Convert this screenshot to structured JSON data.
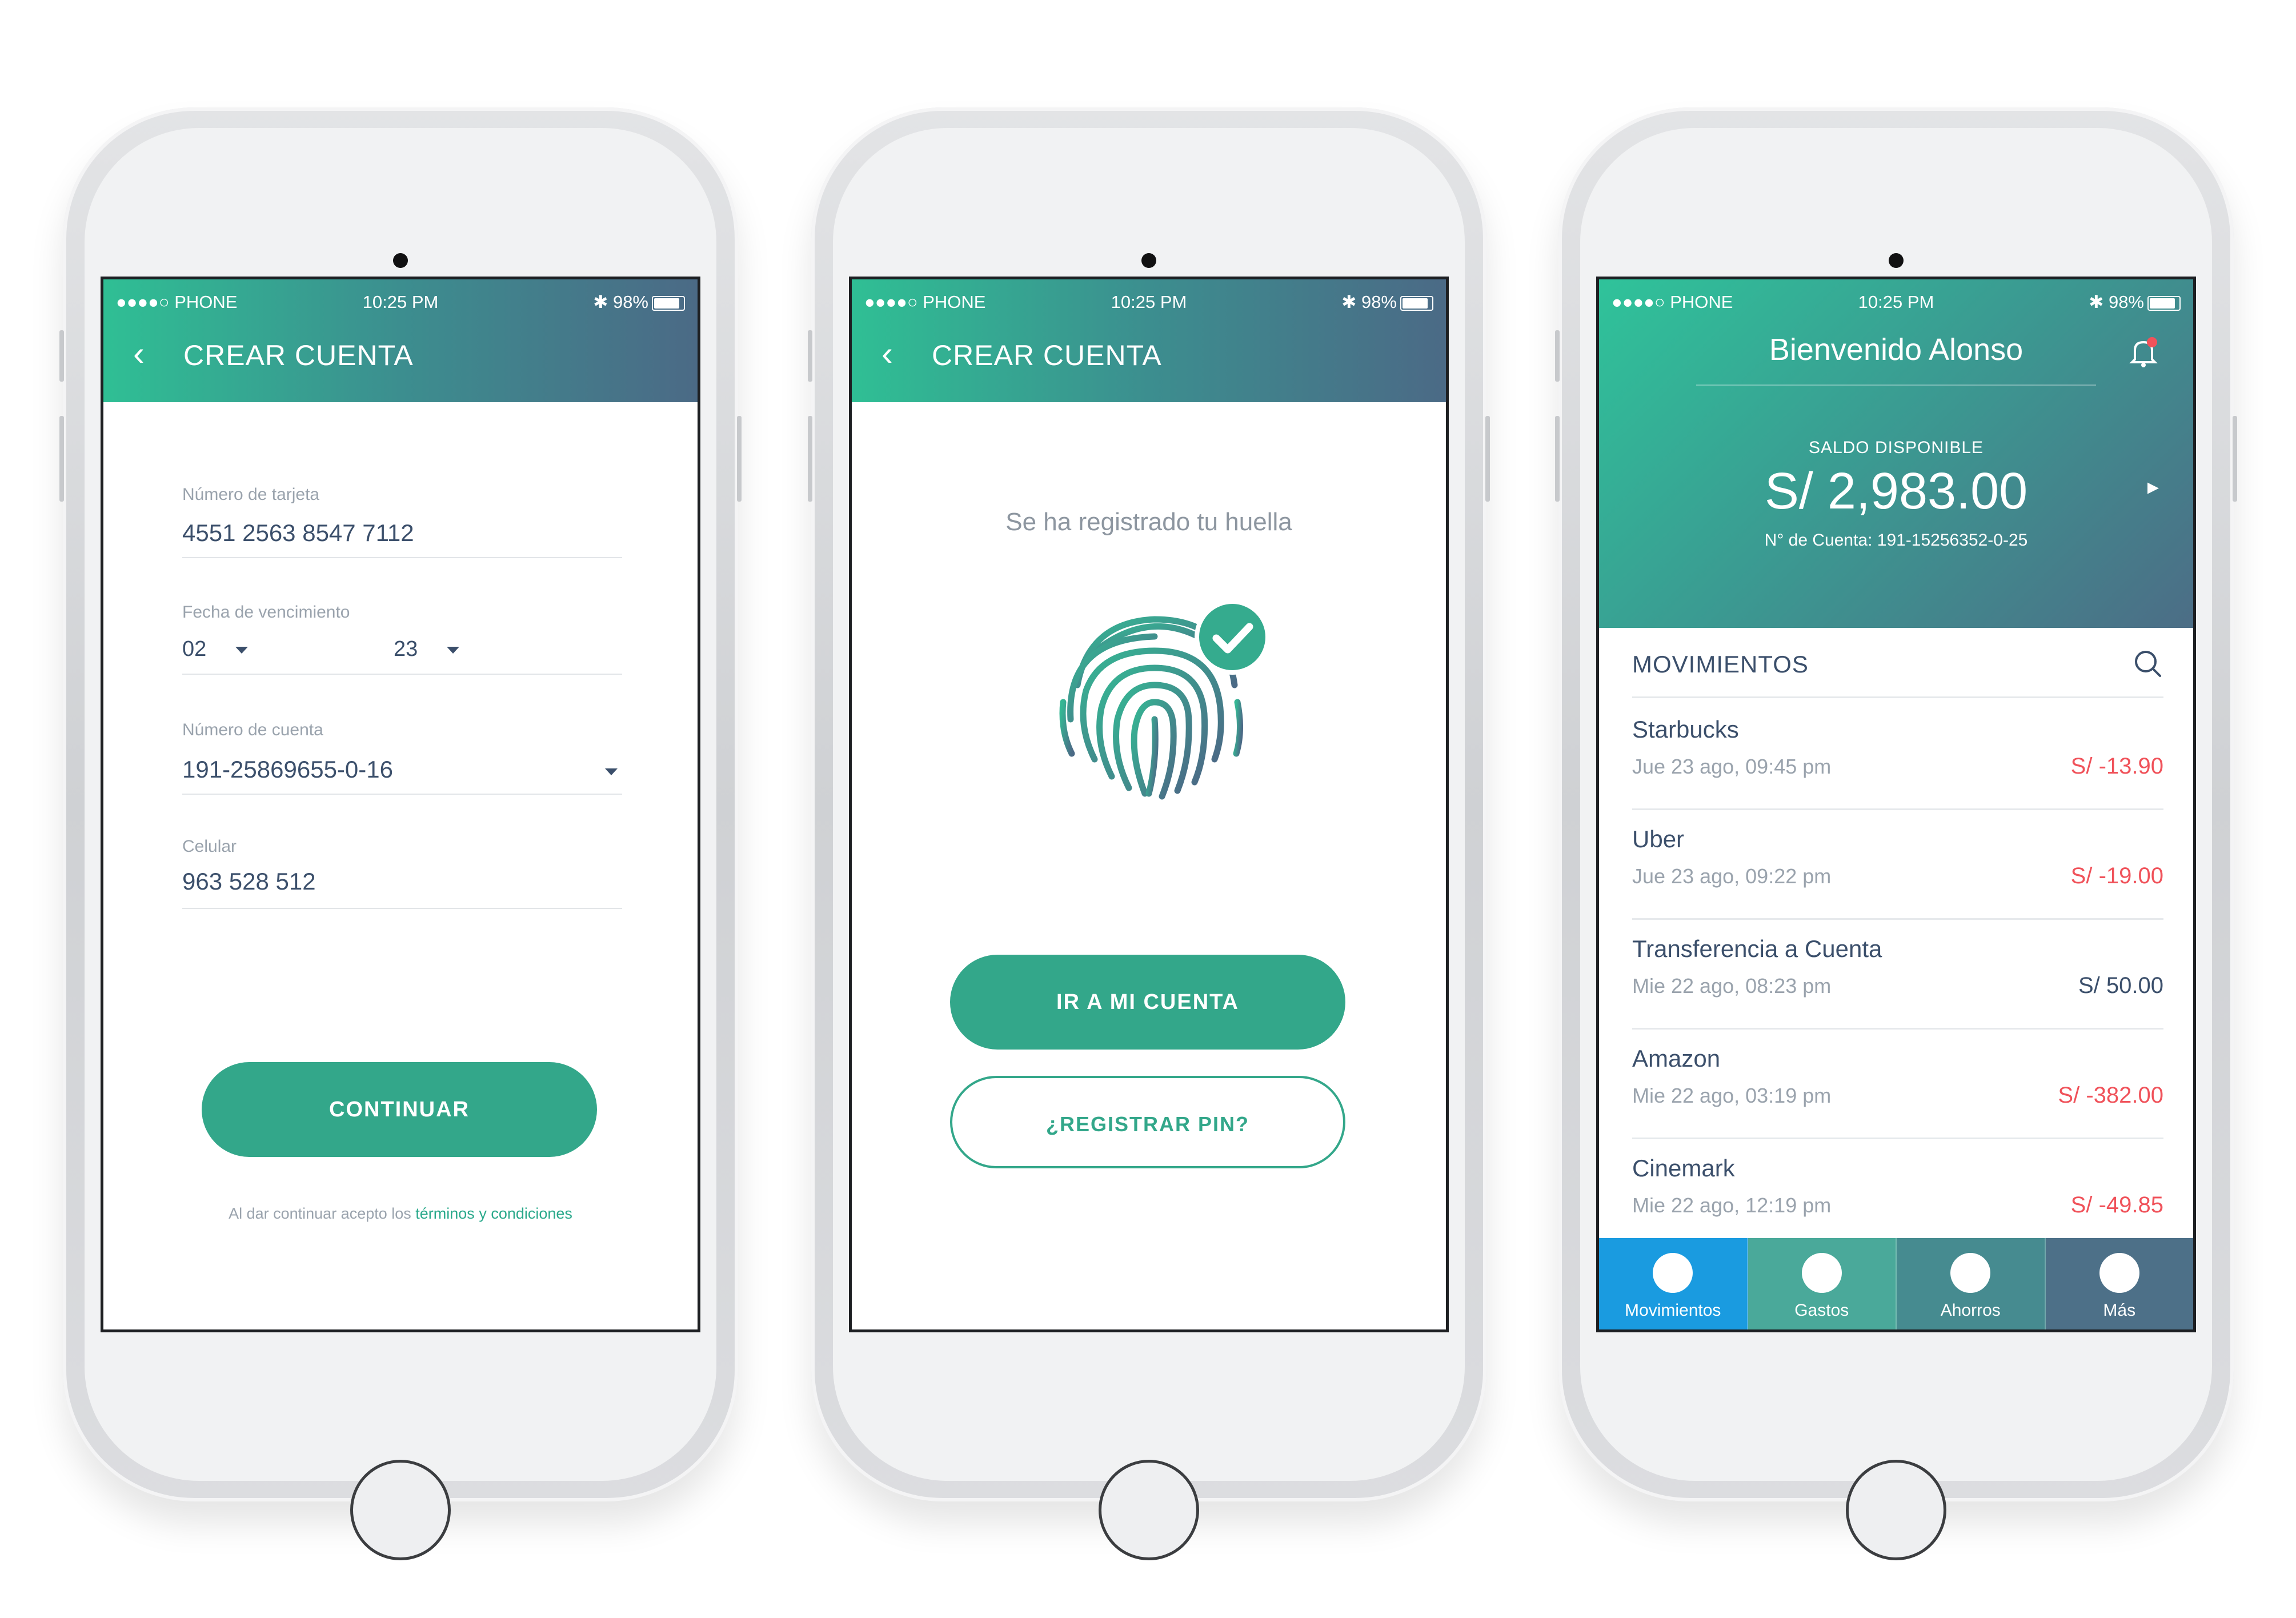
{
  "status_bar": {
    "carrier": "●●●●○ PHONE",
    "time": "10:25 PM",
    "battery": "98%"
  },
  "screen1": {
    "title": "CREAR CUENTA",
    "card_label": "Número de tarjeta",
    "card_value": "4551 2563 8547 7112",
    "expiry_label": "Fecha de vencimiento",
    "expiry_month": "02",
    "expiry_year": "23",
    "account_label": "Número de cuenta",
    "account_value": "191-25869655-0-16",
    "phone_label": "Celular",
    "phone_value": "963 528 512",
    "continue_label": "CONTINUAR",
    "terms_text": "Al dar continuar acepto los ",
    "terms_link": "términos y condiciones"
  },
  "screen2": {
    "title": "CREAR CUENTA",
    "message": "Se ha registrado tu huella",
    "primary_label": "IR A MI CUENTA",
    "secondary_label": "¿REGISTRAR PIN?"
  },
  "screen3": {
    "greeting": "Bienvenido Alonso",
    "balance_label": "SALDO DISPONIBLE",
    "balance": "S/ 2,983.00",
    "account": "N° de Cuenta: 191-15256352-0-25",
    "movements_title": "MOVIMIENTOS",
    "movements": [
      {
        "name": "Starbucks",
        "date": "Jue 23 ago, 09:45 pm",
        "amount": "S/ -13.90",
        "negative": true
      },
      {
        "name": "Uber",
        "date": "Jue 23 ago, 09:22 pm",
        "amount": "S/ -19.00",
        "negative": true
      },
      {
        "name": "Transferencia a Cuenta",
        "date": "Mie 22 ago, 08:23 pm",
        "amount": "S/ 50.00",
        "negative": false
      },
      {
        "name": "Amazon",
        "date": "Mie 22 ago, 03:19 pm",
        "amount": "S/ -382.00",
        "negative": true
      },
      {
        "name": "Cinemark",
        "date": "Mie 22 ago, 12:19 pm",
        "amount": "S/ -49.85",
        "negative": true
      }
    ],
    "tabs": [
      "Movimientos",
      "Gastos",
      "Ahorros",
      "Más"
    ]
  },
  "colors": {
    "accent": "#33a78a",
    "negative": "#f0525a",
    "text": "#3b4f6b",
    "active_tab": "#1a9be0"
  }
}
